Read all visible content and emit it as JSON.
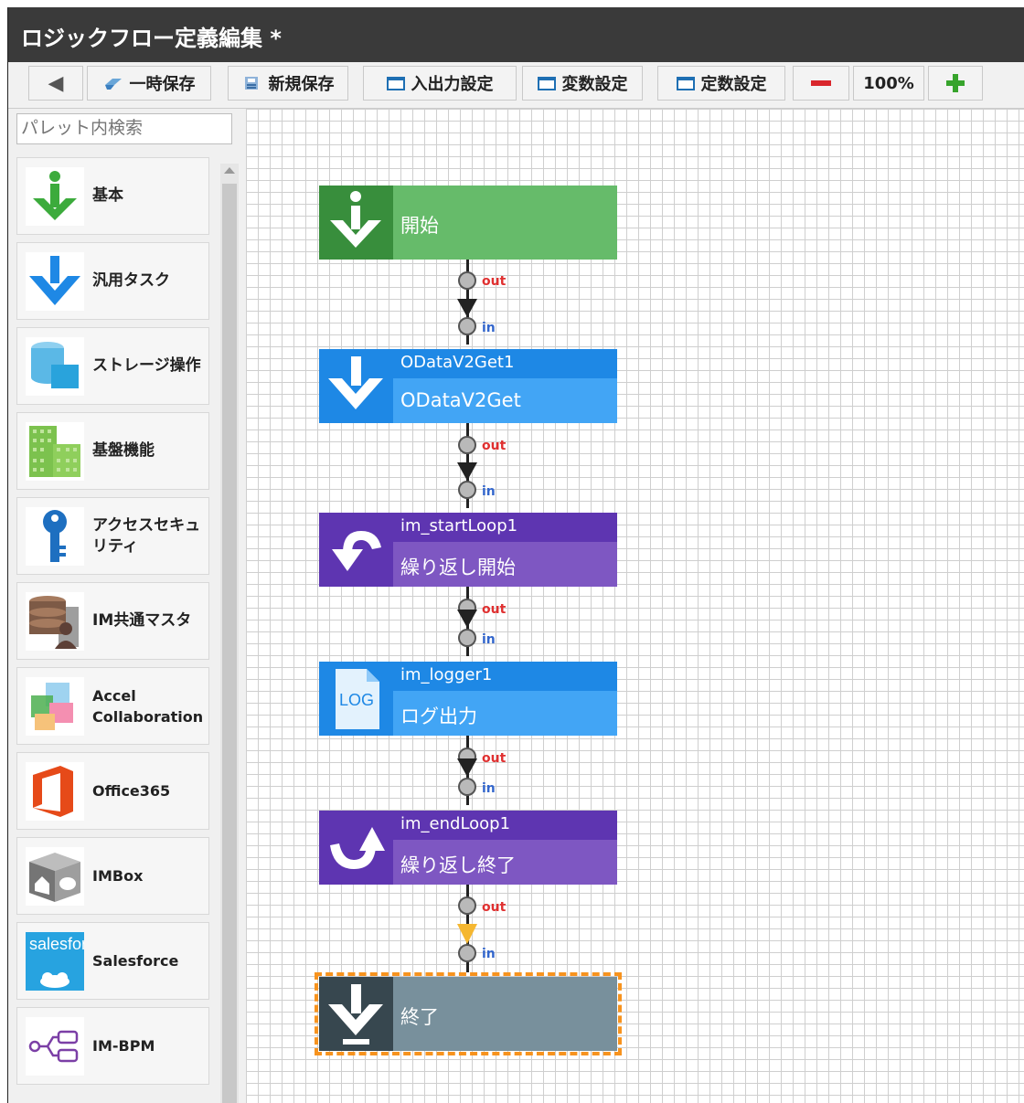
{
  "window": {
    "title": "ロジックフロー定義編集 *"
  },
  "toolbar": {
    "back_icon": "left-arrow-icon",
    "temp_save": "一時保存",
    "new_save": "新規保存",
    "io_settings": "入出力設定",
    "var_settings": "変数設定",
    "const_settings": "定数設定",
    "zoom": "100%"
  },
  "palette": {
    "search_placeholder": "パレット内検索",
    "items": [
      {
        "label": "基本",
        "icon": "basic-down-arrow-icon"
      },
      {
        "label": "汎用タスク",
        "icon": "generic-task-icon"
      },
      {
        "label": "ストレージ操作",
        "icon": "storage-icon"
      },
      {
        "label": "基盤機能",
        "icon": "platform-grid-icon"
      },
      {
        "label": "アクセスセキュリティ",
        "icon": "key-icon"
      },
      {
        "label": "IM共通マスタ",
        "icon": "master-db-icon"
      },
      {
        "label": "Accel Collaboration",
        "icon": "collaboration-icon"
      },
      {
        "label": "Office365",
        "icon": "office365-icon"
      },
      {
        "label": "IMBox",
        "icon": "imbox-icon"
      },
      {
        "label": "Salesforce",
        "icon": "salesforce-icon",
        "logo_text": "salesforce"
      },
      {
        "label": "IM-BPM",
        "icon": "bpm-icon"
      }
    ]
  },
  "flow": {
    "nodes": [
      {
        "id": "",
        "name": "開始",
        "type": "start"
      },
      {
        "id": "ODataV2Get1",
        "name": "ODataV2Get",
        "type": "task"
      },
      {
        "id": "im_startLoop1",
        "name": "繰り返し開始",
        "type": "loop-start"
      },
      {
        "id": "im_logger1",
        "name": "ログ出力",
        "type": "logger",
        "icon_text": "LOG"
      },
      {
        "id": "im_endLoop1",
        "name": "繰り返し終了",
        "type": "loop-end"
      },
      {
        "id": "",
        "name": "終了",
        "type": "end"
      }
    ],
    "port_out": "out",
    "port_in": "in"
  },
  "colors": {
    "start": "#66bb6a",
    "task": "#42a5f5",
    "loop": "#7e57c2",
    "end": "#78909c",
    "selection": "#f7931e",
    "highlight_arrow": "#f5b731"
  }
}
